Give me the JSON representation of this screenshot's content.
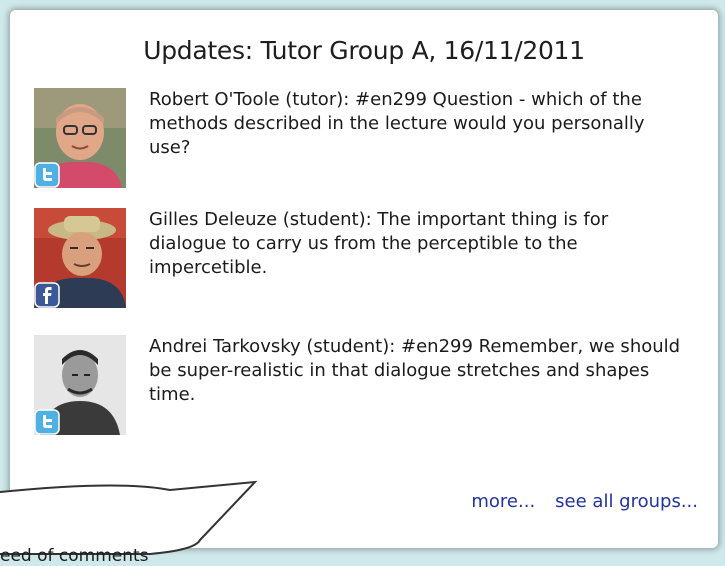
{
  "header": {
    "title": "Updates: Tutor Group A, 16/11/2011"
  },
  "updates": [
    {
      "author": "Robert O'Toole (tutor)",
      "source": "twitter",
      "text": "Robert O'Toole (tutor): #en299 Question - which of the methods described in the lecture would you personally use?"
    },
    {
      "author": "Gilles Deleuze (student)",
      "source": "facebook",
      "text": "Gilles Deleuze (student): The important thing is for dialogue to carry us from the perceptible to the impercetible."
    },
    {
      "author": "Andrei Tarkovsky (student)",
      "source": "twitter",
      "text": "Andrei Tarkovsky (student): #en299 Remember, we should be super-realistic in that dialogue stretches and shapes time."
    }
  ],
  "links": {
    "more": "more...",
    "all_groups": "see all groups..."
  },
  "callout": {
    "text": "eed of comments"
  },
  "colors": {
    "background": "#cfe8ea",
    "link": "#223399",
    "twitter": "#4fb0e3",
    "facebook": "#3b5998"
  },
  "icons": {
    "twitter": "twitter-icon",
    "facebook": "facebook-icon"
  }
}
